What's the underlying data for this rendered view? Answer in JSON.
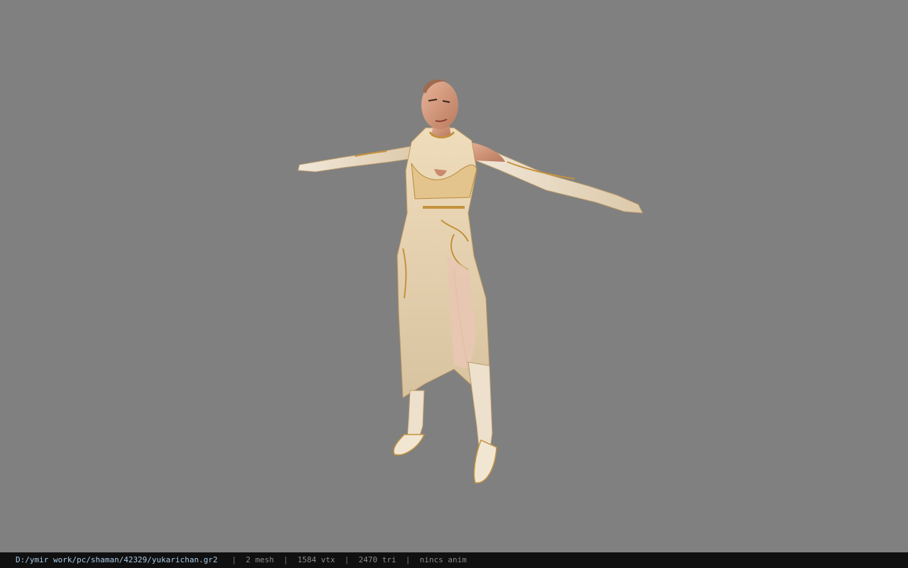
{
  "viewer": {
    "background_color": "#808080",
    "model_name": "yukarichan"
  },
  "status": {
    "file_path": "D:/ymir work/pc/shaman/42329/yukarichan.gr2",
    "separator": "|",
    "mesh": "2 mesh",
    "vertices": "1584 vtx",
    "triangles": "2470 tri",
    "anim": "nincs anim"
  }
}
